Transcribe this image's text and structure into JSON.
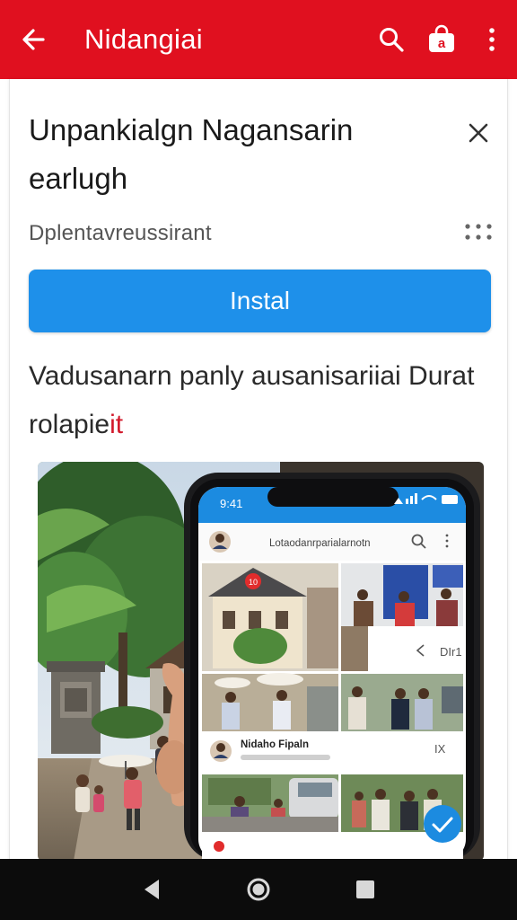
{
  "appbar": {
    "title": "Nidangiai",
    "back_icon": "arrow-back-icon",
    "search_icon": "search-icon",
    "bag_icon": "shopping-bag-icon",
    "more_icon": "more-vert-icon",
    "bag_letter": "a",
    "color": "#e0101f"
  },
  "card": {
    "headline": "Unpankialgn Nagansarin earlugh",
    "developer": "Dplentavreussirant",
    "install_label": "Instal",
    "install_color": "#1e90ea",
    "description_main": "Vadusanarn panly ausanisariiai Durat rolapie",
    "description_accent": "it",
    "accent_color": "#d2192b"
  },
  "phone": {
    "time": "9:41",
    "app_title": "Lotaodanrparialarnotn",
    "red_badge": "10",
    "side_label": "DIr1",
    "post_user": "Nidaho Fipaln",
    "post_action": "IX"
  }
}
